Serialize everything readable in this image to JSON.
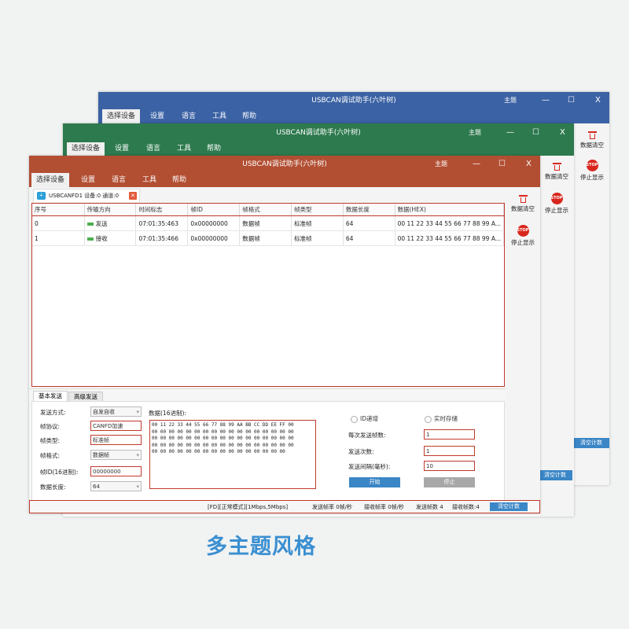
{
  "app": {
    "title": "USBCAN调试助手(六叶树)",
    "theme_label": "主题",
    "min_glyph": "—",
    "max_glyph": "☐",
    "close_glyph": "X"
  },
  "menu": [
    "选择设备",
    "设置",
    "语言",
    "工具",
    "帮助"
  ],
  "sidebar": {
    "clear_label": "数据清空",
    "stop_label": "停止显示",
    "stop_icon_text": "STOP"
  },
  "tab": {
    "label": "USBCANFD1 设备:0 通道:0",
    "close_glyph": "✕"
  },
  "table": {
    "headers": [
      "序号",
      "传输方向",
      "时间标志",
      "帧ID",
      "帧格式",
      "帧类型",
      "数据长度",
      "数据(HEX)"
    ],
    "rows": [
      [
        "0",
        "发送",
        "07:01:35:463",
        "0x00000000",
        "数据帧",
        "标准帧",
        "64",
        "00 11 22 33 44 55 66 77 88 99 A..."
      ],
      [
        "1",
        "接收",
        "07:01:35:466",
        "0x00000000",
        "数据帧",
        "标准帧",
        "64",
        "00 11 22 33 44 55 66 77 88 99 A..."
      ]
    ]
  },
  "send": {
    "tabs": [
      "基本发送",
      "高级发送"
    ],
    "labels": {
      "mode": "发送方式:",
      "protocol": "帧协议:",
      "frame_type": "帧类型:",
      "frame_format": "帧格式:",
      "frame_id": "帧ID(16进制):",
      "data_len": "数据长度:",
      "data": "数据(16进制):",
      "id_incr": "ID递增",
      "realtime_save": "实时存储",
      "frames_per_send": "每次发送帧数:",
      "send_count": "发送次数:",
      "send_interval": "发送间隔(毫秒):"
    },
    "values": {
      "mode": "自发自收",
      "protocol": "CANFD加速",
      "frame_type": "标准帧",
      "frame_format": "数据帧",
      "frame_id": "00000000",
      "data_len": "64",
      "data_lines": [
        "00 11 22 33 44 55 66 77 88 99 AA BB CC DD EE FF 00",
        "00 00 00 00 00 00 00 00 00 00 00 00 00 00 00 00 00",
        "00 00 00 00 00 00 00 00 00 00 00 00 00 00 00 00 00",
        "00 00 00 00 00 00 00 00 00 00 00 00 00 00 00 00 00",
        "00 00 00 00 00 00 00 00 00 00 00 00 00 00 00 00"
      ],
      "frames_per_send": "1",
      "send_count": "1",
      "send_interval": "10"
    },
    "start_label": "开始",
    "stop_label": "停止"
  },
  "status": {
    "mode": "[FD][正常模式][1Mbps,5Mbps]",
    "send_rate": "发送帧率 0帧/秒",
    "recv_rate": "接收帧率 0帧/秒",
    "send_frames": "发送帧数 4",
    "recv_frames": "接收帧数:4",
    "clear_count": "清空计数"
  },
  "caption": "多主题风格",
  "colors": {
    "blue": "#3b62a4",
    "green": "#2d7a4e",
    "orange": "#b24f33",
    "caption": "#3a8fd1"
  }
}
